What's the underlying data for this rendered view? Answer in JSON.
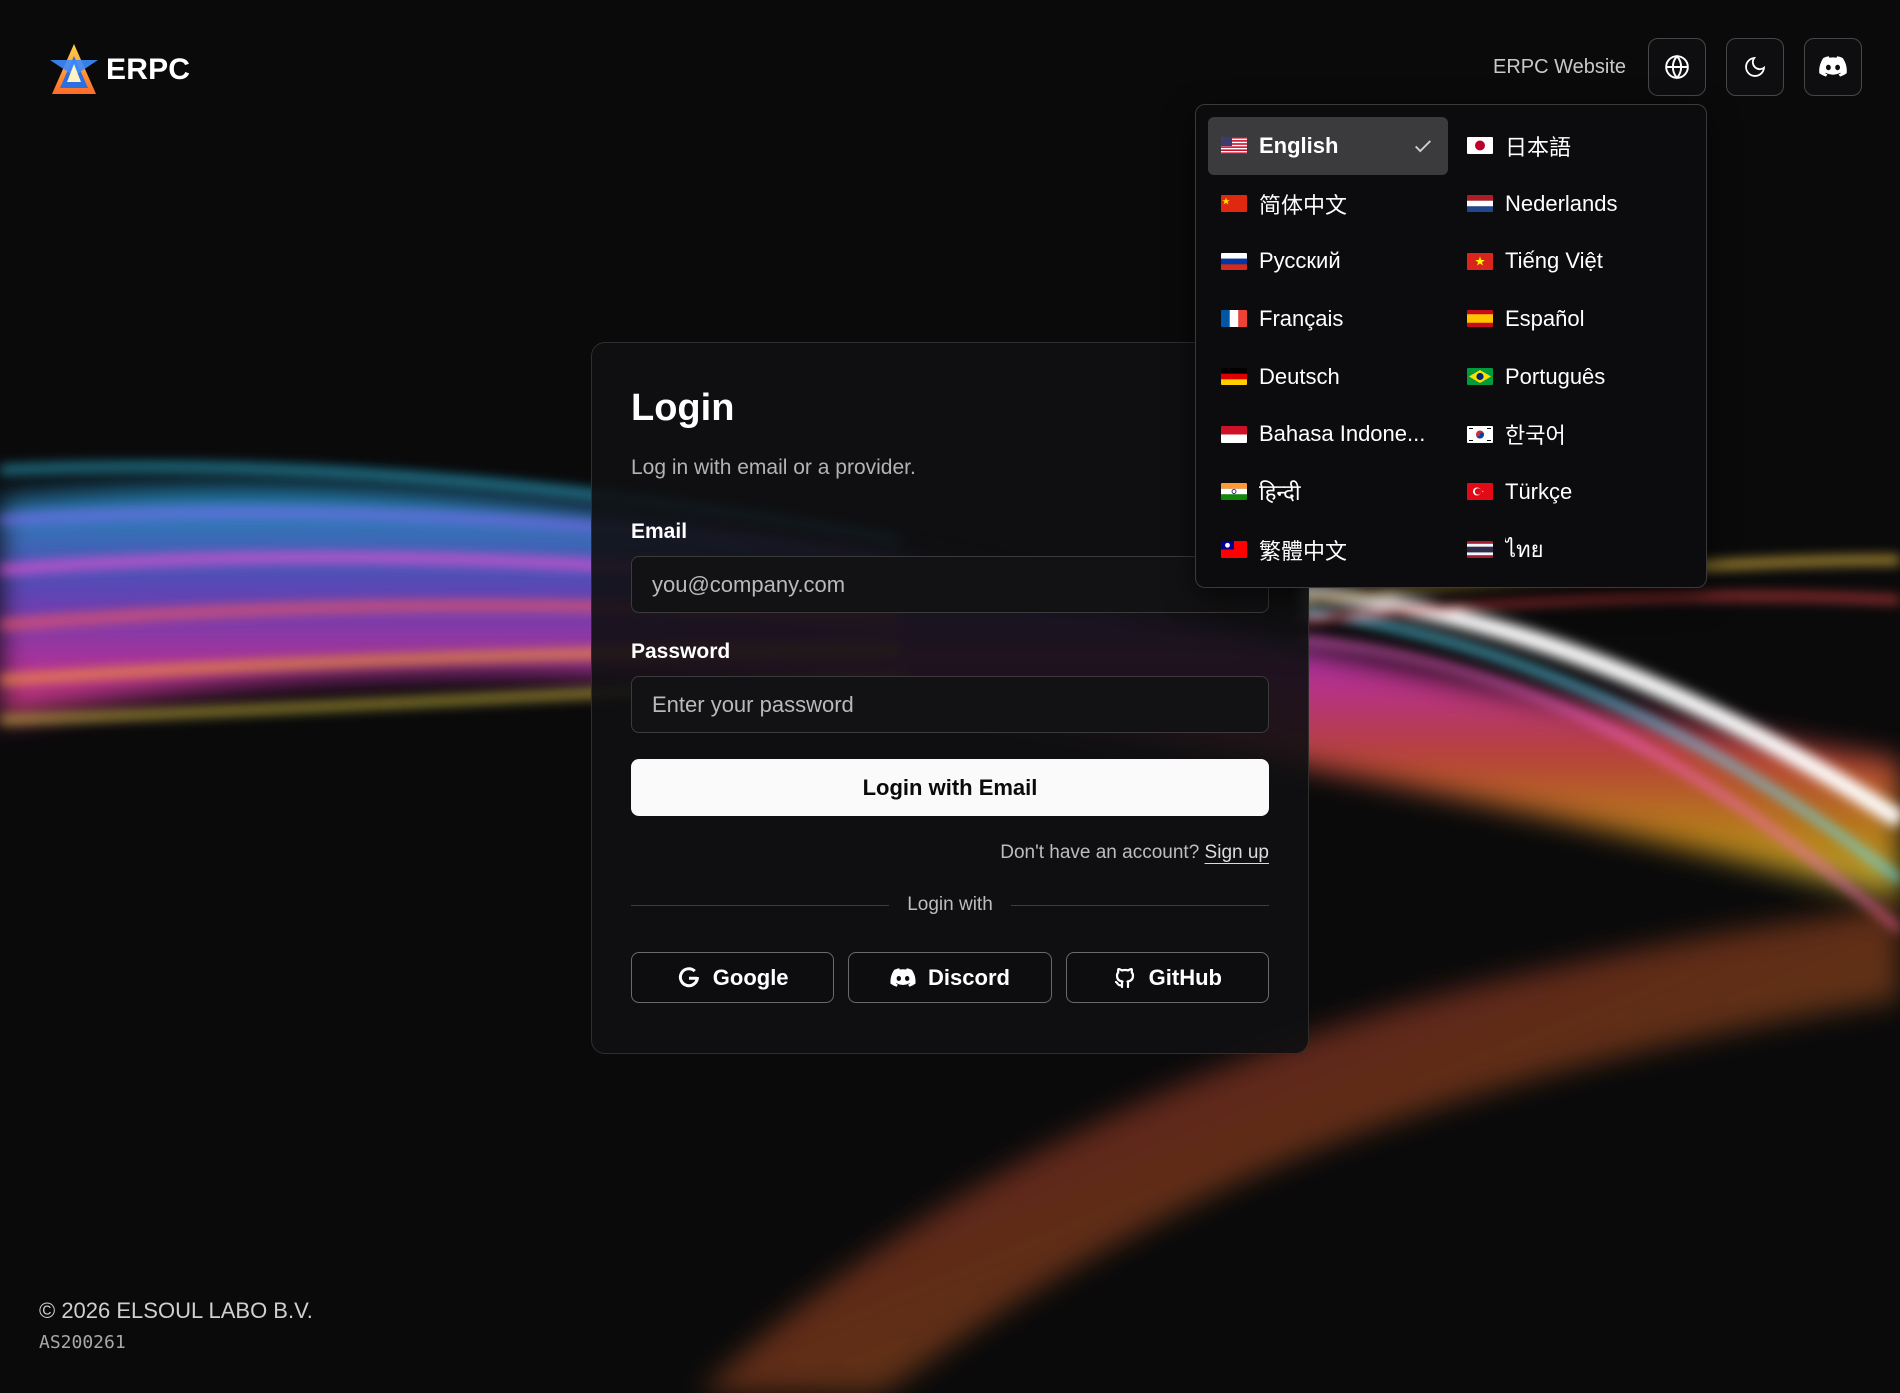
{
  "header": {
    "brand": "ERPC",
    "site_link": "ERPC Website",
    "buttons": [
      {
        "icon": "globe-icon"
      },
      {
        "icon": "moon-icon"
      },
      {
        "icon": "discord-icon"
      }
    ]
  },
  "login": {
    "title": "Login",
    "subtitle": "Log in with email or a provider.",
    "email_label": "Email",
    "email_placeholder": "you@company.com",
    "password_label": "Password",
    "password_placeholder": "Enter your password",
    "submit_label": "Login with Email",
    "signup_prompt": "Don't have an account?",
    "signup_link": "Sign up",
    "divider_text": "Login with",
    "providers": [
      {
        "label": "Google",
        "icon": "google-icon"
      },
      {
        "label": "Discord",
        "icon": "discord-icon"
      },
      {
        "label": "GitHub",
        "icon": "github-icon"
      }
    ]
  },
  "language_menu": {
    "selected": "English",
    "items": [
      {
        "label": "English",
        "flag": "us"
      },
      {
        "label": "日本語",
        "flag": "jp"
      },
      {
        "label": "简体中文",
        "flag": "cn"
      },
      {
        "label": "Nederlands",
        "flag": "nl"
      },
      {
        "label": "Русский",
        "flag": "ru"
      },
      {
        "label": "Tiếng Việt",
        "flag": "vn"
      },
      {
        "label": "Français",
        "flag": "fr"
      },
      {
        "label": "Español",
        "flag": "es"
      },
      {
        "label": "Deutsch",
        "flag": "de"
      },
      {
        "label": "Português",
        "flag": "br"
      },
      {
        "label": "Bahasa Indone...",
        "flag": "id"
      },
      {
        "label": "한국어",
        "flag": "kr"
      },
      {
        "label": "हिन्दी",
        "flag": "in"
      },
      {
        "label": "Türkçe",
        "flag": "tr"
      },
      {
        "label": "繁體中文",
        "flag": "tw"
      },
      {
        "label": "ไทย",
        "flag": "th"
      }
    ]
  },
  "footer": {
    "copyright": "© 2026 ELSOUL LABO B.V.",
    "asn": "AS200261"
  },
  "colors": {
    "background": "#0a0a0b",
    "card": "#101012",
    "primary_button": "#fafafa",
    "selected_item": "#3b3b3d"
  }
}
